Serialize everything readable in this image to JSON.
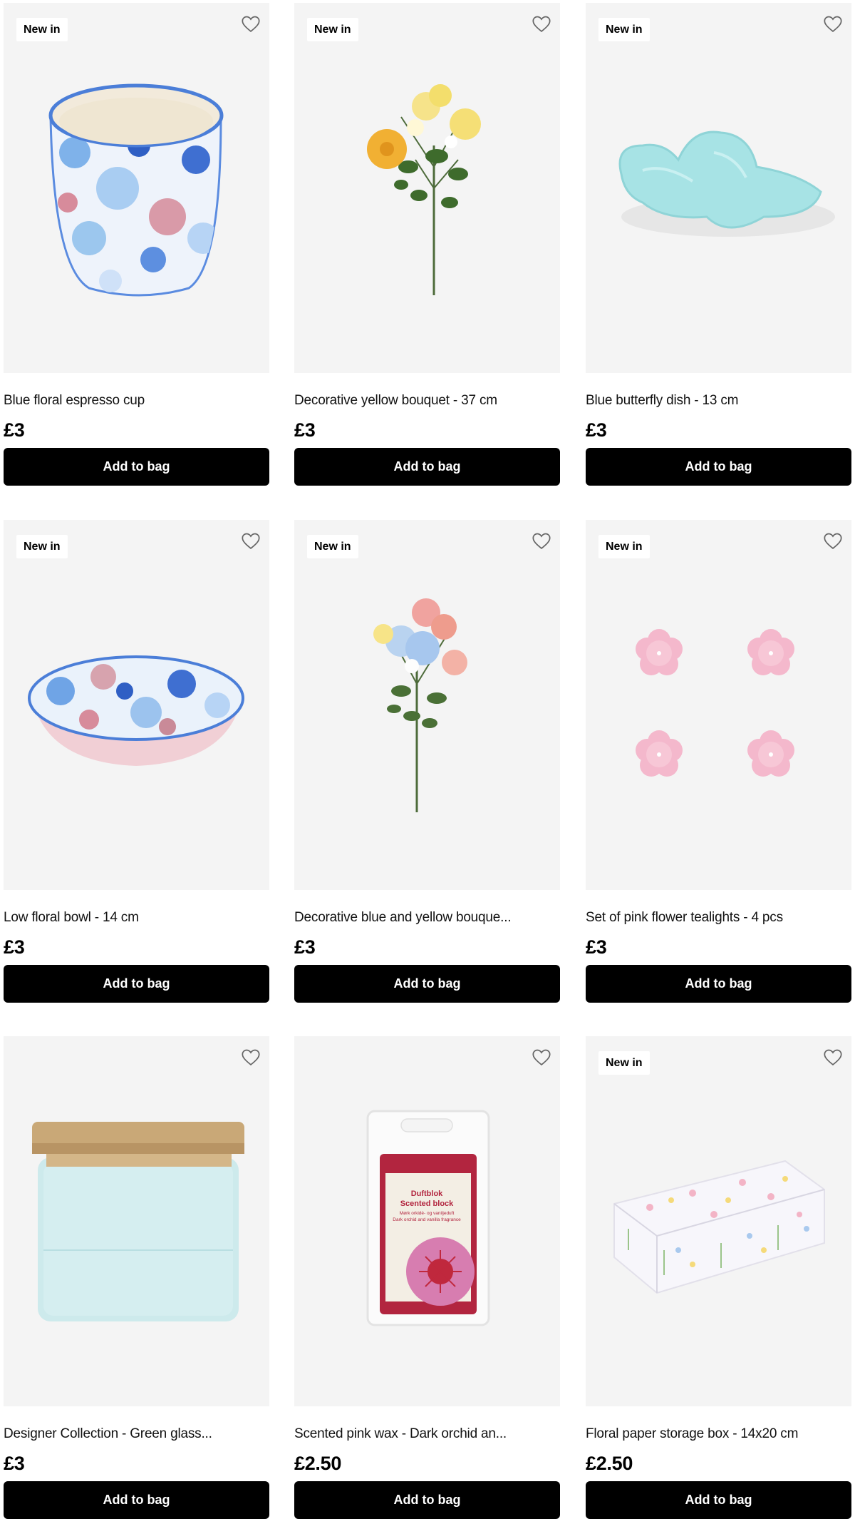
{
  "products": [
    {
      "badge": "New in",
      "title": "Blue floral espresso cup",
      "price": "£3",
      "button": "Add to bag",
      "image": "blue-floral-cup-image"
    },
    {
      "badge": "New in",
      "title": "Decorative yellow bouquet - 37 cm",
      "price": "£3",
      "button": "Add to bag",
      "image": "yellow-bouquet-image"
    },
    {
      "badge": "New in",
      "title": "Blue butterfly dish - 13 cm",
      "price": "£3",
      "button": "Add to bag",
      "image": "butterfly-dish-image"
    },
    {
      "badge": "New in",
      "title": "Low floral bowl - 14 cm",
      "price": "£3",
      "button": "Add to bag",
      "image": "floral-bowl-image"
    },
    {
      "badge": "New in",
      "title": "Decorative blue and yellow bouque...",
      "price": "£3",
      "button": "Add to bag",
      "image": "blue-yellow-bouquet-image"
    },
    {
      "badge": "New in",
      "title": "Set of pink flower tealights - 4 pcs",
      "price": "£3",
      "button": "Add to bag",
      "image": "pink-tealights-image"
    },
    {
      "badge": "",
      "title": "Designer Collection - Green glass...",
      "price": "£3",
      "button": "Add to bag",
      "image": "glass-jar-image"
    },
    {
      "badge": "",
      "title": "Scented pink wax - Dark orchid an...",
      "price": "£2.50",
      "button": "Add to bag",
      "image": "scented-wax-image"
    },
    {
      "badge": "New in",
      "title": "Floral paper storage box - 14x20 cm",
      "price": "£2.50",
      "button": "Add to bag",
      "image": "storage-box-image"
    }
  ],
  "wax_package": {
    "line1": "Duftblok",
    "line2": "Scented block",
    "line3": "Mørk orkidé- og vaniljeduft",
    "line4": "Dark orchid and vanilla fragrance"
  },
  "icons": {
    "wishlist": "heart-outline-icon"
  },
  "colors": {
    "button_bg": "#000000",
    "button_text": "#ffffff",
    "card_bg": "#f4f4f4",
    "badge_bg": "#ffffff"
  }
}
